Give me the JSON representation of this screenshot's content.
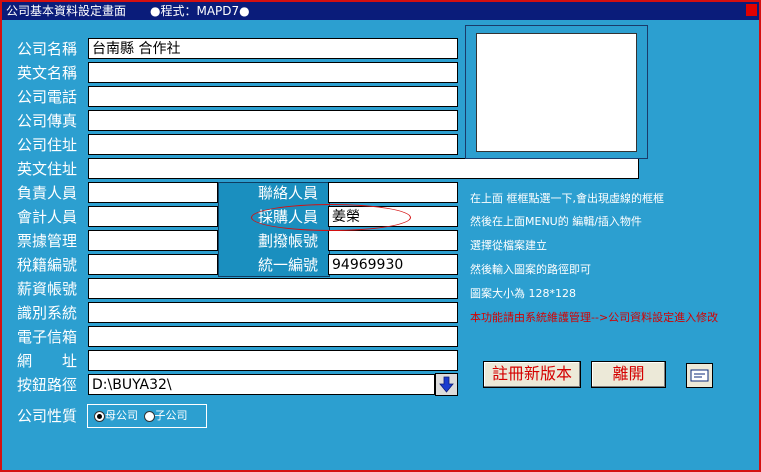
{
  "window": {
    "title": "公司基本資料設定畫面",
    "program": "●程式：MAPD7●"
  },
  "labels": {
    "company_name": "公司名稱",
    "english_name": "英文名稱",
    "phone": "公司電話",
    "fax": "公司傳真",
    "address": "公司住址",
    "english_address": "英文住址",
    "owner": "負責人員",
    "accountant": "會計人員",
    "bill_manager": "票據管理",
    "tax_id": "稅籍編號",
    "payroll_account": "薪資帳號",
    "id_system": "識別系統",
    "email": "電子信箱",
    "website_a": "網",
    "website_b": "址",
    "button_path": "按鈕路徑",
    "company_type": "公司性質",
    "contact": "聯絡人員",
    "purchasing": "採購人員",
    "transfer_account": "劃撥帳號",
    "unified_number": "統一編號"
  },
  "fields": {
    "company_name": "台南縣 合作社",
    "english_name": "",
    "phone": "",
    "fax": "",
    "address": "",
    "english_address": "",
    "owner": "",
    "accountant": "",
    "bill_manager": "",
    "tax_id": "",
    "payroll_account": "",
    "id_system": "",
    "email": "",
    "website": "",
    "button_path": "D:\\BUYA32\\",
    "contact": "",
    "purchasing": "姜榮",
    "transfer_account": "",
    "unified_number": "94969930"
  },
  "company_type": {
    "options": [
      "母公司",
      "子公司"
    ],
    "selected": "母公司"
  },
  "info_lines": [
    "在上面 框框點選一下,會出現虛線的框框",
    "然後在上面MENU的 編輯/插入物件",
    "選擇從檔案建立",
    "然後輸入圖案的路徑即可",
    "圖案大小為 128*128"
  ],
  "info_warning": "本功能請由系統維護管理-->公司資料設定進入修改",
  "buttons": {
    "register": "註冊新版本",
    "exit": "離開",
    "help": "?"
  },
  "colors": {
    "background": "#2c9fd0",
    "titlebar": "#0a1c7a",
    "border": "#d41010",
    "button_text": "#d40000"
  }
}
